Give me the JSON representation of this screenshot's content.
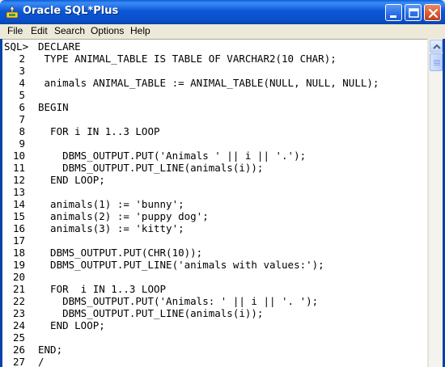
{
  "window": {
    "title": "Oracle SQL*Plus"
  },
  "menu": {
    "items": [
      "File",
      "Edit",
      "Search",
      "Options",
      "Help"
    ]
  },
  "console": {
    "lines": [
      {
        "prompt": "SQL>",
        "text": "DECLARE"
      },
      {
        "prompt": "2",
        "text": " TYPE ANIMAL_TABLE IS TABLE OF VARCHAR2(10 CHAR);"
      },
      {
        "prompt": "3",
        "text": ""
      },
      {
        "prompt": "4",
        "text": " animals ANIMAL_TABLE := ANIMAL_TABLE(NULL, NULL, NULL);"
      },
      {
        "prompt": "5",
        "text": ""
      },
      {
        "prompt": "6",
        "text": "BEGIN"
      },
      {
        "prompt": "7",
        "text": ""
      },
      {
        "prompt": "8",
        "text": "  FOR i IN 1..3 LOOP"
      },
      {
        "prompt": "9",
        "text": ""
      },
      {
        "prompt": "10",
        "text": "    DBMS_OUTPUT.PUT('Animals ' || i || '.');"
      },
      {
        "prompt": "11",
        "text": "    DBMS_OUTPUT.PUT_LINE(animals(i));"
      },
      {
        "prompt": "12",
        "text": "  END LOOP;"
      },
      {
        "prompt": "13",
        "text": ""
      },
      {
        "prompt": "14",
        "text": "  animals(1) := 'bunny';"
      },
      {
        "prompt": "15",
        "text": "  animals(2) := 'puppy dog';"
      },
      {
        "prompt": "16",
        "text": "  animals(3) := 'kitty';"
      },
      {
        "prompt": "17",
        "text": ""
      },
      {
        "prompt": "18",
        "text": "  DBMS_OUTPUT.PUT(CHR(10));"
      },
      {
        "prompt": "19",
        "text": "  DBMS_OUTPUT.PUT_LINE('animals with values:');"
      },
      {
        "prompt": "20",
        "text": ""
      },
      {
        "prompt": "21",
        "text": "  FOR  i IN 1..3 LOOP"
      },
      {
        "prompt": "22",
        "text": "    DBMS_OUTPUT.PUT('Animals: ' || i || '. ');"
      },
      {
        "prompt": "23",
        "text": "    DBMS_OUTPUT.PUT_LINE(animals(i));"
      },
      {
        "prompt": "24",
        "text": "  END LOOP;"
      },
      {
        "prompt": "25",
        "text": ""
      },
      {
        "prompt": "26",
        "text": "END;"
      },
      {
        "prompt": "27",
        "text": "/"
      }
    ]
  },
  "colors": {
    "titlebar": "#0a4fc8",
    "close_button": "#d9582e",
    "console_background": "#ffffff",
    "menubar_background": "#ece9d8"
  },
  "icons": {
    "app": "oracle-plus-icon",
    "minimize": "minimize-icon",
    "maximize": "maximize-icon",
    "close": "close-icon",
    "scroll_up": "scroll-up-arrow-icon"
  }
}
